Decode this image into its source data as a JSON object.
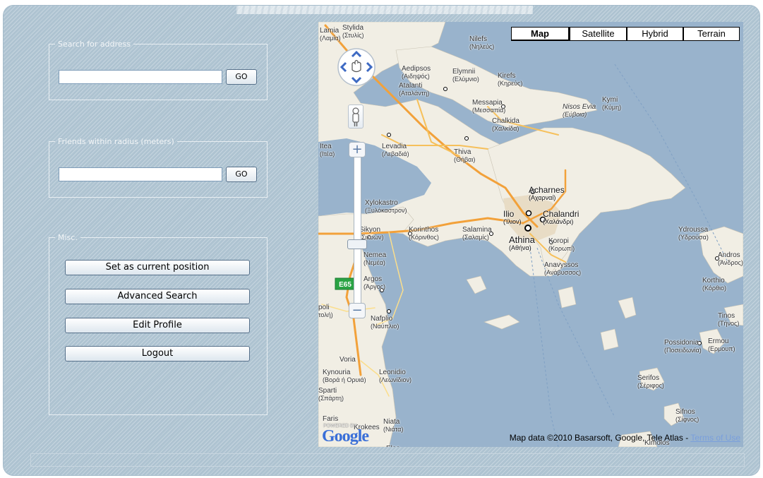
{
  "search_address": {
    "legend": "Search for address",
    "input_value": "",
    "button_label": "GO"
  },
  "friends_radius": {
    "legend": "Friends within radius (meters)",
    "input_value": "",
    "button_label": "GO"
  },
  "misc": {
    "legend": "Misc.",
    "buttons": [
      "Set as current position",
      "Advanced Search",
      "Edit Profile",
      "Logout"
    ]
  },
  "map": {
    "type_buttons": [
      "Map",
      "Satellite",
      "Hybrid",
      "Terrain"
    ],
    "active_type": "Map",
    "attribution": "Map data ©2010 Basarsoft, Google, Tele Atlas - ",
    "terms_link": "Terms of Use",
    "logo_powered": "POWERED BY",
    "logo_word": "Google",
    "road_shield": "E65",
    "labels": [
      {
        "name": "Lamia",
        "greek": "(Λαμία)"
      },
      {
        "name": "Stylida",
        "greek": "(Στυλίς)"
      },
      {
        "name": "Nilefs",
        "greek": "(Νηλεύς)"
      },
      {
        "name": "Aedipsos",
        "greek": "(Αιδηψός)"
      },
      {
        "name": "Elymnii",
        "greek": "(Ελύμνιο)"
      },
      {
        "name": "Kirefs",
        "greek": "(Κηρεύς)"
      },
      {
        "name": "Atalanti",
        "greek": "(Αταλάντη)"
      },
      {
        "name": "Kymi",
        "greek": "(Κύμη)"
      },
      {
        "name": "Messapia",
        "greek": "(Μεσσαπία)"
      },
      {
        "name": "Nisos Evia",
        "greek": "(Εύβοια)"
      },
      {
        "name": "Chalkida",
        "greek": "(Χαλκίδα)"
      },
      {
        "name": "Itea",
        "greek": "(Ιτέα)"
      },
      {
        "name": "Levadia",
        "greek": "(Λεβαδιά)"
      },
      {
        "name": "Thiva",
        "greek": "(Θήβαι)"
      },
      {
        "name": "Acharnes",
        "greek": "(Αχαρναί)"
      },
      {
        "name": "Xylokastro",
        "greek": "(Ξυλόκαστρον)"
      },
      {
        "name": "Ilio",
        "greek": "(Ίλιον)"
      },
      {
        "name": "Chalandri",
        "greek": "(Χαλάνδρι)"
      },
      {
        "name": "Sikyon",
        "greek": "(Σικυών)"
      },
      {
        "name": "Korinthos",
        "greek": "(Κόρινθος)"
      },
      {
        "name": "Salamina",
        "greek": "(Σαλαμίς)"
      },
      {
        "name": "Athina",
        "greek": "(Αθήνα)"
      },
      {
        "name": "Koropi",
        "greek": "(Κορωπί)"
      },
      {
        "name": "Ydroussa",
        "greek": "(Υδρούσα)"
      },
      {
        "name": "Andros",
        "greek": "(Άνδρος)"
      },
      {
        "name": "Nemea",
        "greek": "(Νεμέα)"
      },
      {
        "name": "Anavyssos",
        "greek": "(Ανάβυσσος)"
      },
      {
        "name": "Korthio",
        "greek": "(Κόρθιο)"
      },
      {
        "name": "Argos",
        "greek": "(Άργος)"
      },
      {
        "name": "Nafplio",
        "greek": "(Ναύπλιο)"
      },
      {
        "name": "Tinos",
        "greek": "(Τήνος)"
      },
      {
        "name": "Possidonia",
        "greek": "(Ποσειδωνία)"
      },
      {
        "name": "Ermou",
        "greek": "(Ερμουπ)"
      },
      {
        "name": "Voria",
        "greek": ""
      },
      {
        "name": "Kynouria",
        "greek": "(Βορά ή Ορυιά)"
      },
      {
        "name": "Leonidio",
        "greek": "(Λεωνίδιον)"
      },
      {
        "name": "Serifos",
        "greek": "(Σέριφος)"
      },
      {
        "name": "Sparti",
        "greek": "(Σπάρτη)"
      },
      {
        "name": "Faris",
        "greek": ""
      },
      {
        "name": "Krokees",
        "greek": ""
      },
      {
        "name": "Niata",
        "greek": "(Νιάτα)"
      },
      {
        "name": "Sifnos",
        "greek": "(Σίφνος)"
      },
      {
        "name": "Kimolos",
        "greek": ""
      },
      {
        "name": "poli",
        "greek": "τολή)"
      },
      {
        "name": "Elos",
        "greek": ""
      }
    ]
  }
}
